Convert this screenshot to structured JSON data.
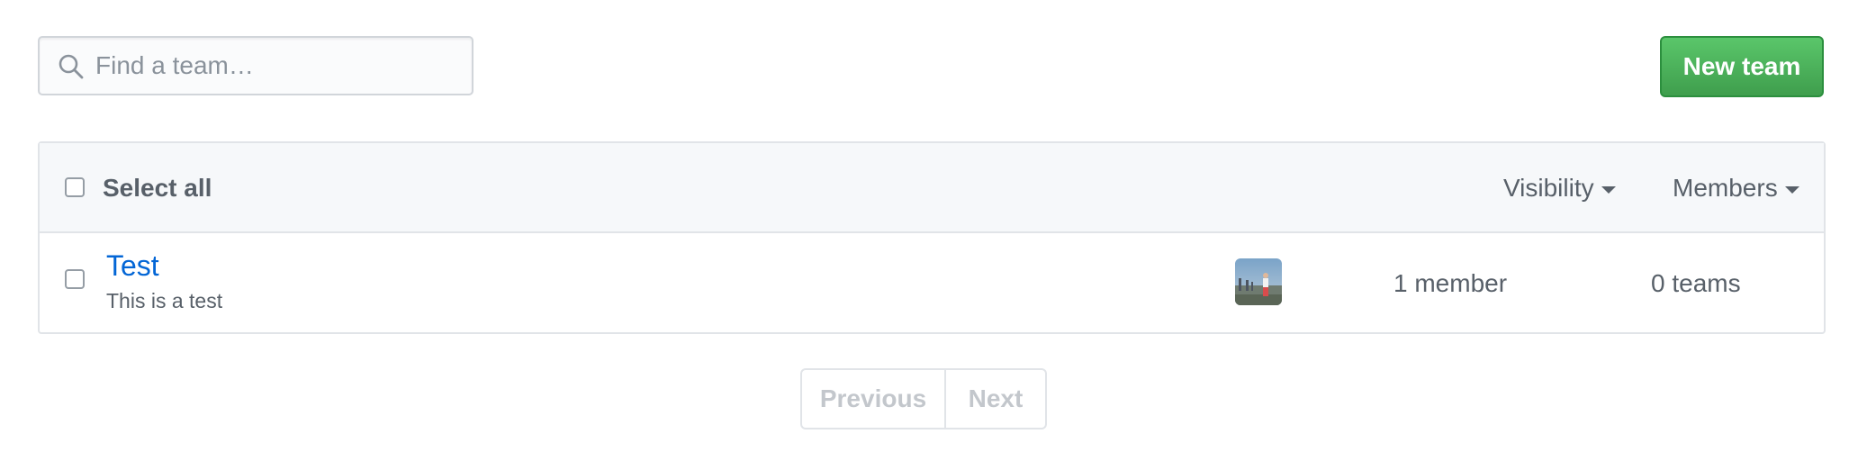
{
  "search": {
    "placeholder": "Find a team…",
    "icon": "search-icon"
  },
  "new_team_button": {
    "label": "New team",
    "color": "#4cae5a"
  },
  "table": {
    "header": {
      "select_all_label": "Select all",
      "visibility_label": "Visibility",
      "members_label": "Members"
    },
    "rows": [
      {
        "name": "Test",
        "description": "This is a test",
        "members": "1 member",
        "teams": "0 teams"
      }
    ]
  },
  "pagination": {
    "previous_label": "Previous",
    "next_label": "Next"
  },
  "colors": {
    "link": "#0366d6",
    "muted": "#586069",
    "border": "#e1e4e8"
  }
}
